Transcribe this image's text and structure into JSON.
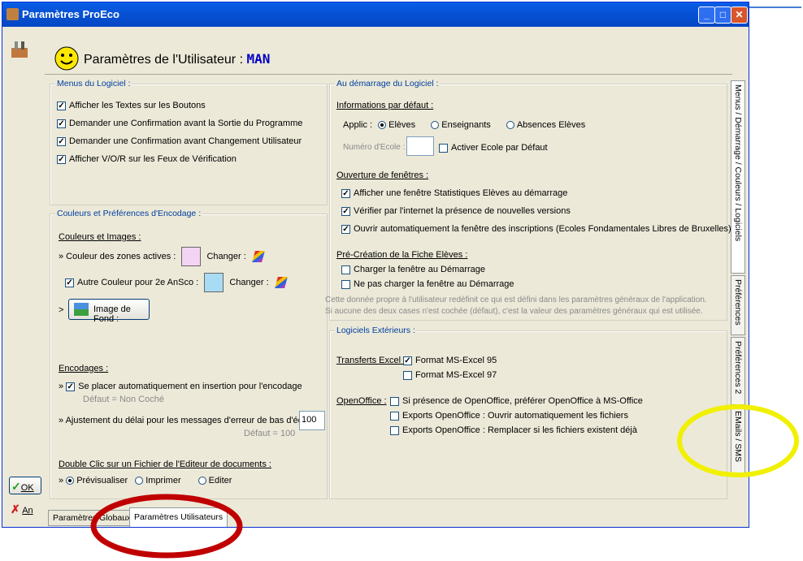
{
  "window": {
    "title": "Paramètres ProEco"
  },
  "header": {
    "title": "Paramètres de l'Utilisateur : ",
    "user": "MAN"
  },
  "menus": {
    "legend": "Menus du Logiciel :",
    "items": [
      "Afficher les Textes sur les Boutons",
      "Demander une Confirmation avant la Sortie du Programme",
      "Demander une Confirmation avant Changement Utilisateur",
      "Afficher V/O/R sur les Feux de Vérification"
    ]
  },
  "couleurs": {
    "legend": "Couleurs et Préférences d'Encodage :",
    "heading": "Couleurs et Images :",
    "active_label": "» Couleur des zones actives :",
    "change_label": "Changer :",
    "ansco_label": "Autre Couleur pour 2e AnSco :",
    "image_button": "Image de Fond :",
    "active_color": "#f4d4f4",
    "ansco_color": "#a8dcf4"
  },
  "encodages": {
    "heading": "Encodages :",
    "insert_label": "Se placer automatiquement en insertion pour l'encodage",
    "insert_default": "Défaut = Non Coché",
    "delay_label": "» Ajustement du délai pour les messages d'erreur de bas d'écran :",
    "delay_value": "100",
    "delay_default": "Défaut = 100",
    "double_heading": "Double Clic sur un Fichier de l'Editeur de documents :",
    "opt_preview": "Prévisualiser",
    "opt_print": "Imprimer",
    "opt_edit": "Editer"
  },
  "demarrage": {
    "legend": "Au démarrage du Logiciel :",
    "info_heading": "Informations par défaut :",
    "applic_label": "Applic :",
    "opt_eleves": "Elèves",
    "opt_enseignants": "Enseignants",
    "opt_absences": "Absences Elèves",
    "ecole_label": "Numéro d'Ecole :",
    "ecole_default": "Activer Ecole par Défaut",
    "fenetres_heading": "Ouverture de fenêtres :",
    "fenetres_items": [
      "Afficher une fenêtre Statistiques Elèves au démarrage",
      "Vérifier par l'internet la présence de nouvelles versions",
      "Ouvrir automatiquement la fenêtre des inscriptions (Ecoles Fondamentales Libres de Bruxelles)"
    ],
    "precreation_heading": "Pré-Création de la Fiche Elèves :",
    "precreation_items": [
      "Charger la fenêtre au Démarrage",
      "Ne pas charger la fenêtre au Démarrage"
    ],
    "note1": "Cette donnée propre à l'utilisateur redéfinit ce qui est défini dans les paramètres généraux de l'application.",
    "note2": "Si aucune des deux cases n'est cochée (défaut), c'est la valeur des paramètres généraux qui est utilisée."
  },
  "exterieurs": {
    "legend": "Logiciels Extérieurs :",
    "excel_label": "Transferts Excel :",
    "excel95": "Format MS-Excel 95",
    "excel97": "Format MS-Excel 97",
    "oo_label": "OpenOffice :",
    "oo_items": [
      "Si présence de OpenOffice, préférer OpenOffice à MS-Office",
      "Exports OpenOffice : Ouvrir automatiquement les fichiers",
      "Exports OpenOffice : Remplacer si les fichiers existent déjà"
    ]
  },
  "side_tabs": [
    "Menus / Démarrage / Couleurs / Logiciels",
    "Préférences",
    "Préférences 2",
    "EMails / SMS"
  ],
  "bottom_tabs": [
    "Paramètres Globaux",
    "Paramètres Utilisateurs"
  ],
  "left_buttons": {
    "ok": "OK",
    "cancel": "An"
  },
  "annotation_colors": {
    "red_circle": "#c00000",
    "yellow_circle": "#f0f000"
  }
}
